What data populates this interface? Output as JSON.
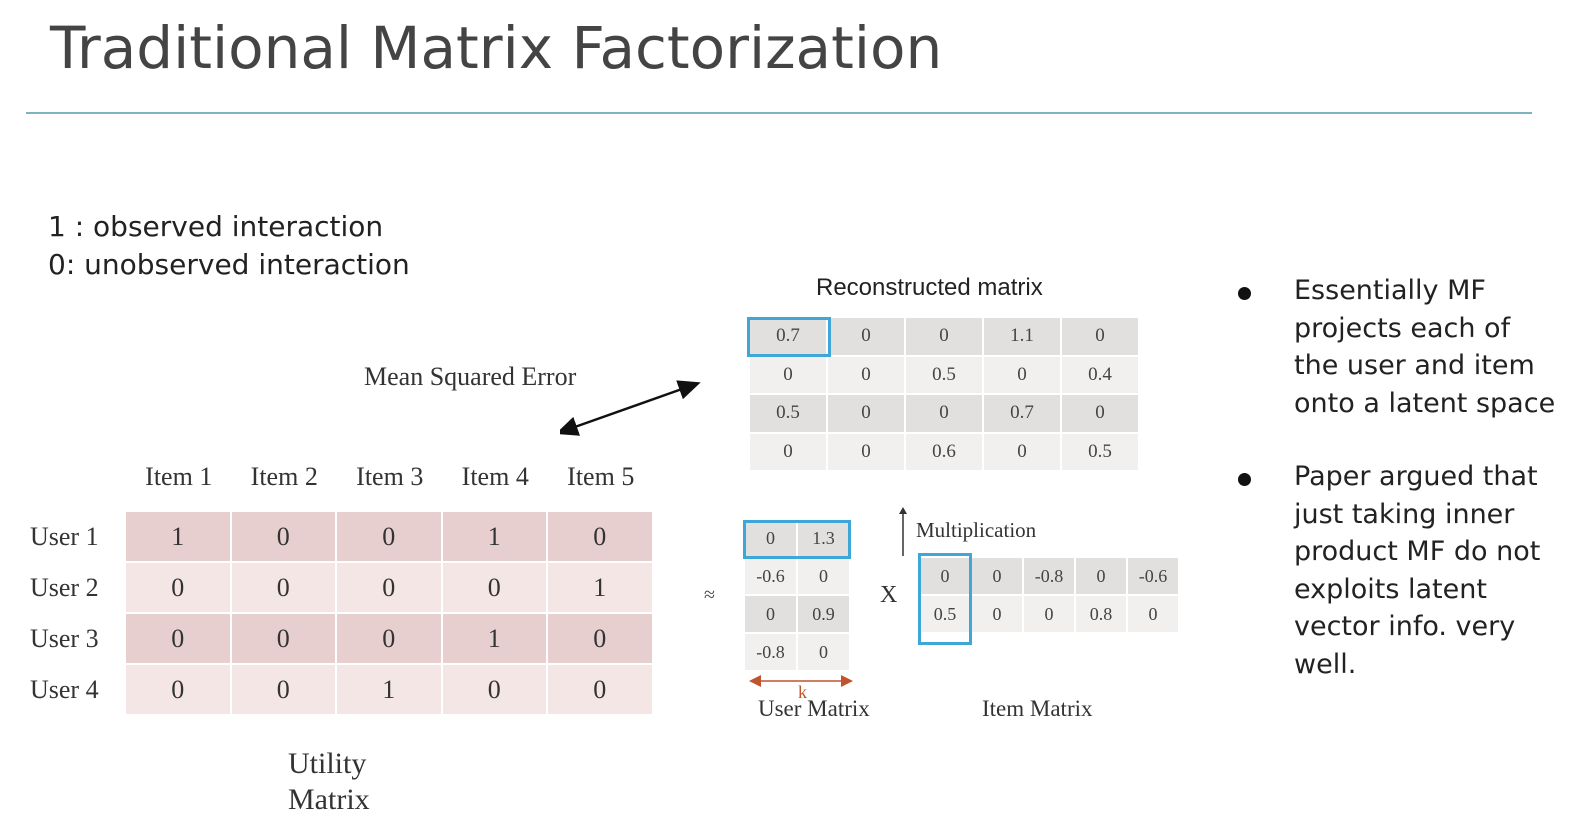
{
  "title": "Traditional Matrix Factorization",
  "legend": {
    "line1": "1 : observed interaction",
    "line2": "0: unobserved interaction"
  },
  "mse_label": "Mean Squared Error",
  "utility": {
    "items": [
      "Item 1",
      "Item 2",
      "Item 3",
      "Item 4",
      "Item 5"
    ],
    "users": [
      "User 1",
      "User 2",
      "User 3",
      "User 4"
    ],
    "values": [
      [
        "1",
        "0",
        "0",
        "1",
        "0"
      ],
      [
        "0",
        "0",
        "0",
        "0",
        "1"
      ],
      [
        "0",
        "0",
        "0",
        "1",
        "0"
      ],
      [
        "0",
        "0",
        "1",
        "0",
        "0"
      ]
    ],
    "caption_line1": "Utility",
    "caption_line2": "Matrix"
  },
  "reconstructed": {
    "title": "Reconstructed matrix",
    "values": [
      [
        "0.7",
        "0",
        "0",
        "1.1",
        "0"
      ],
      [
        "0",
        "0",
        "0.5",
        "0",
        "0.4"
      ],
      [
        "0.5",
        "0",
        "0",
        "0.7",
        "0"
      ],
      [
        "0",
        "0",
        "0.6",
        "0",
        "0.5"
      ]
    ]
  },
  "user_matrix": {
    "values": [
      [
        "0",
        "1.3"
      ],
      [
        "-0.6",
        "0"
      ],
      [
        "0",
        "0.9"
      ],
      [
        "-0.8",
        "0"
      ]
    ],
    "k_label": "k",
    "label": "User Matrix"
  },
  "item_matrix": {
    "values": [
      [
        "0",
        "0",
        "-0.8",
        "0",
        "-0.6"
      ],
      [
        "0.5",
        "0",
        "0",
        "0.8",
        "0"
      ]
    ],
    "label": "Item Matrix"
  },
  "approx_symbol": "≈",
  "times_symbol": "X",
  "multiplication_label": "Multiplication",
  "bullets": [
    "Essentially MF projects each of the user and  item onto a latent space",
    "Paper argued that just taking inner product MF do not exploits latent vector info. very well."
  ],
  "colors": {
    "highlight": "#3fa6d8",
    "rule": "#7fb3bf",
    "utility_dark": "#e8cfcf",
    "utility_light": "#f5e6e6",
    "k_arrow": "#c0542c"
  }
}
